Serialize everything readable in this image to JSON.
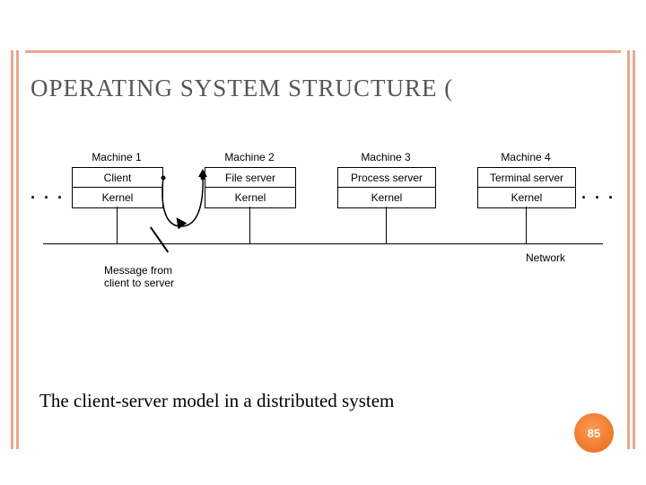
{
  "title": "OPERATING SYSTEM STRUCTURE (",
  "caption": "The client-server model in a distributed system",
  "page_number": "85",
  "ellipsis_left": "· · ·",
  "ellipsis_right": "· · ·",
  "network_label": "Network",
  "message_label_1": "Message from",
  "message_label_2": "client to server",
  "machines": [
    {
      "name": "Machine 1",
      "role": "Client",
      "bottom": "Kernel"
    },
    {
      "name": "Machine 2",
      "role": "File server",
      "bottom": "Kernel"
    },
    {
      "name": "Machine 3",
      "role": "Process server",
      "bottom": "Kernel"
    },
    {
      "name": "Machine 4",
      "role": "Terminal server",
      "bottom": "Kernel"
    }
  ],
  "chart_data": {
    "type": "diagram",
    "title": "Client-server model in a distributed system",
    "nodes": [
      {
        "id": "m1",
        "label": "Machine 1",
        "layers": [
          "Client",
          "Kernel"
        ]
      },
      {
        "id": "m2",
        "label": "Machine 2",
        "layers": [
          "File server",
          "Kernel"
        ]
      },
      {
        "id": "m3",
        "label": "Machine 3",
        "layers": [
          "Process server",
          "Kernel"
        ]
      },
      {
        "id": "m4",
        "label": "Machine 4",
        "layers": [
          "Terminal server",
          "Kernel"
        ]
      }
    ],
    "edges": [
      {
        "from": "m1",
        "to": "network",
        "kind": "link"
      },
      {
        "from": "m2",
        "to": "network",
        "kind": "link"
      },
      {
        "from": "m3",
        "to": "network",
        "kind": "link"
      },
      {
        "from": "m4",
        "to": "network",
        "kind": "link"
      },
      {
        "from": "m1",
        "to": "m2",
        "kind": "message",
        "label": "Message from client to server"
      }
    ],
    "bus": {
      "id": "network",
      "label": "Network"
    }
  }
}
